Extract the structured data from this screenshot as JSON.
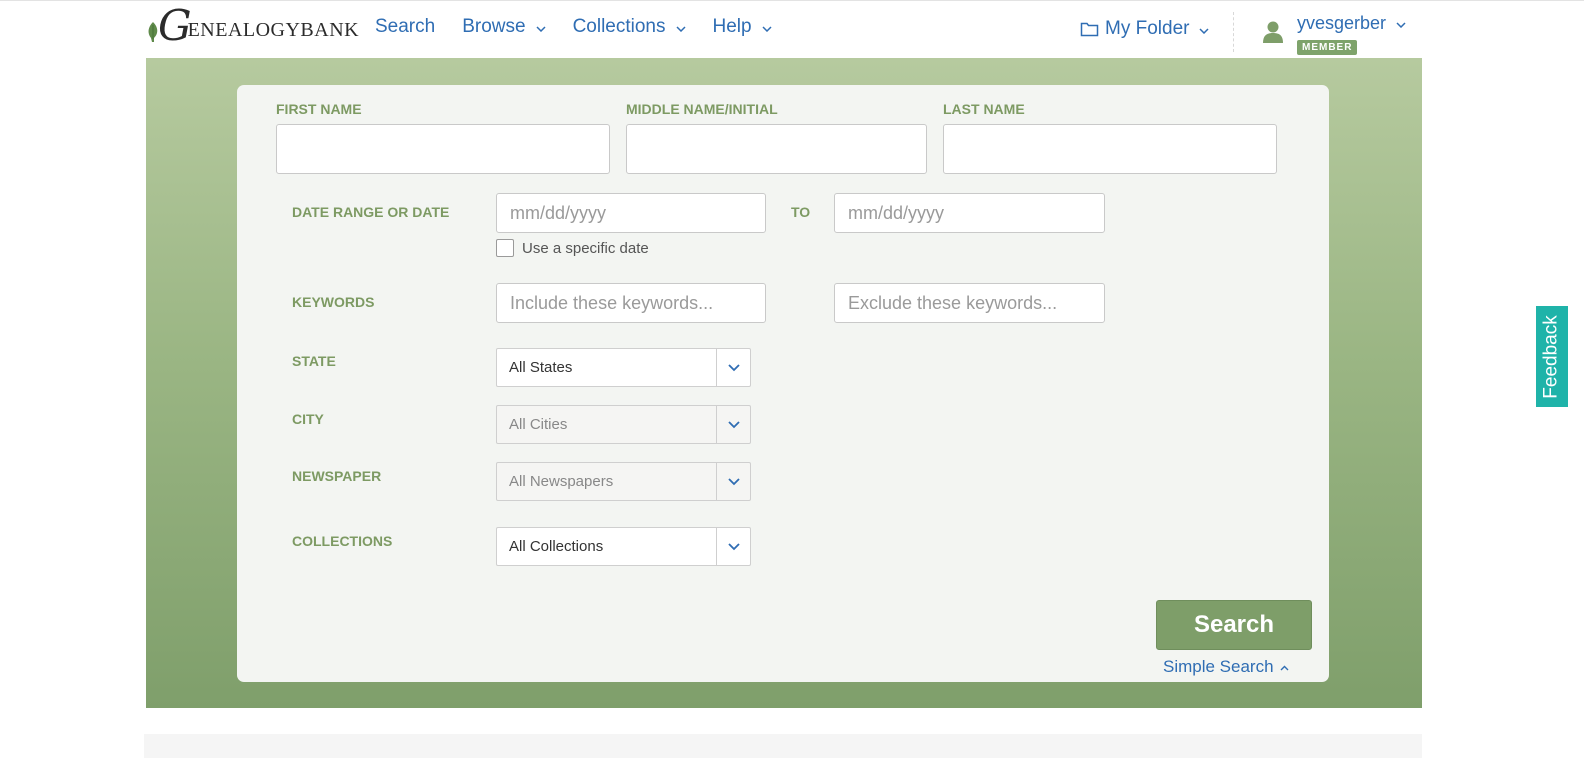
{
  "header": {
    "logo": {
      "initial": "G",
      "rest": "ENEALOGYBANK"
    },
    "nav": [
      {
        "label": "Search",
        "has_dropdown": false
      },
      {
        "label": "Browse",
        "has_dropdown": true
      },
      {
        "label": "Collections",
        "has_dropdown": true
      },
      {
        "label": "Help",
        "has_dropdown": true
      }
    ],
    "folder_label": "My Folder",
    "username": "yvesgerber",
    "member_badge": "MEMBER"
  },
  "form": {
    "first_name_label": "FIRST NAME",
    "middle_name_label": "MIDDLE NAME/INITIAL",
    "last_name_label": "LAST NAME",
    "first_name_value": "",
    "middle_name_value": "",
    "last_name_value": "",
    "date_label": "DATE RANGE OR DATE",
    "date_from_placeholder": "mm/dd/yyyy",
    "date_to_label": "TO",
    "date_to_placeholder": "mm/dd/yyyy",
    "specific_date_label": "Use a specific date",
    "specific_date_checked": false,
    "keywords_label": "KEYWORDS",
    "include_placeholder": "Include these keywords...",
    "exclude_placeholder": "Exclude these keywords...",
    "state_label": "STATE",
    "state_value": "All States",
    "city_label": "CITY",
    "city_value": "All Cities",
    "newspaper_label": "NEWSPAPER",
    "newspaper_value": "All Newspapers",
    "collections_label": "COLLECTIONS",
    "collections_value": "All Collections",
    "search_button": "Search",
    "simple_search_link": "Simple Search"
  },
  "feedback_tab": "Feedback",
  "colors": {
    "link_blue": "#2f6db3",
    "label_green": "#7d9a63",
    "button_green": "#7e9e69",
    "feedback_teal": "#1fb3a9"
  }
}
